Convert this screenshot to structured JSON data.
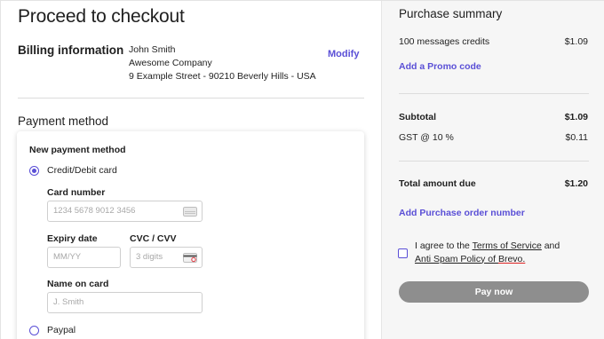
{
  "checkout": {
    "title": "Proceed to checkout",
    "billing": {
      "label": "Billing information",
      "name": "John Smith",
      "company": "Awesome Company",
      "address": "9 Example Street - 90210 Beverly Hills - USA",
      "modify_label": "Modify"
    },
    "payment": {
      "label": "Payment method",
      "new_method_label": "New payment method",
      "credit_label": "Credit/Debit card",
      "card_number_label": "Card number",
      "card_number_placeholder": "1234 5678 9012 3456",
      "expiry_label": "Expiry date",
      "expiry_placeholder": "MM/YY",
      "cvc_label": "CVC / CVV",
      "cvc_placeholder": "3 digits",
      "name_label": "Name on card",
      "name_placeholder": "J. Smith",
      "paypal_label": "Paypal",
      "selected": "credit"
    }
  },
  "summary": {
    "title": "Purchase summary",
    "item_label": "100 messages credits",
    "item_price": "$1.09",
    "promo_label": "Add a Promo code",
    "subtotal_label": "Subtotal",
    "subtotal_value": "$1.09",
    "gst_label": "GST @ 10 %",
    "gst_value": "$0.11",
    "total_label": "Total amount due",
    "total_value": "$1.20",
    "po_label": "Add Purchase order number",
    "agree_prefix": "I agree to the ",
    "terms_label": "Terms of Service",
    "agree_mid": " and",
    "antispam_label": "Anti Spam Policy of ",
    "brevo_label": "Brevo.",
    "pay_label": "Pay now"
  },
  "colors": {
    "accent": "#5a4fd6",
    "pay_button": "#8e8e8e",
    "panel_bg": "#f6f6f6"
  },
  "icons": {
    "card": "credit-card-icon",
    "cvc": "cvc-card-icon"
  }
}
